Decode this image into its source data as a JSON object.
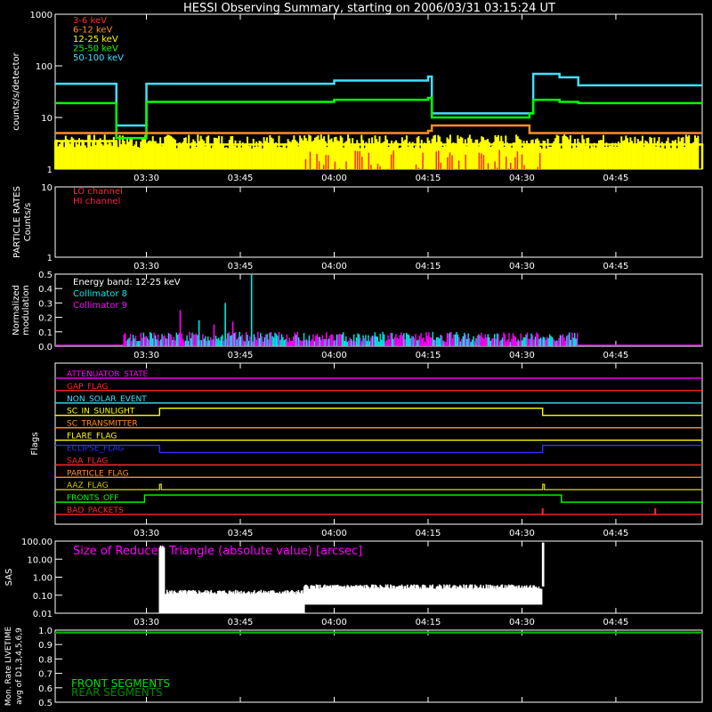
{
  "title": "HESSI Observing Summary, starting on 2006/03/31 03:15:24 UT",
  "colors": {
    "bg": "#000000",
    "axes": "#ffffff",
    "e3_6": "#ff2a2a",
    "e6_12": "#ff8c28",
    "e12_25": "#ffff00",
    "e25_50": "#00ff00",
    "e50_100": "#40e0ff",
    "coll8": "#00e8e8",
    "coll9": "#ff00ff",
    "sas": "#ffffff",
    "front": "#00e000",
    "rear": "#008c00"
  },
  "time_ticks": [
    "03:30",
    "03:45",
    "04:00",
    "04:15",
    "04:30",
    "04:45"
  ],
  "chart_data": [
    {
      "type": "line",
      "panel": "count rates",
      "ylabel": "counts/s/detector",
      "yscale": "log",
      "ylim": [
        1,
        1000
      ],
      "yticks": [
        "1000",
        "100",
        "10",
        "1"
      ],
      "legend": [
        "3-6 keV",
        "6-12 keV",
        "12-25 keV",
        "25-50 keV",
        "50-100 keV"
      ],
      "x_hours": [
        3.257,
        3.4,
        3.42,
        3.49,
        3.5,
        4.0,
        4.25,
        4.26,
        4.28,
        4.52,
        4.53,
        4.6,
        4.65,
        4.98
      ],
      "series": [
        {
          "name": "50-100 keV",
          "values": [
            45,
            45,
            7,
            7,
            45,
            52,
            62,
            12,
            12,
            12,
            70,
            60,
            42,
            42
          ]
        },
        {
          "name": "25-50 keV",
          "values": [
            19,
            19,
            4,
            4,
            20,
            22,
            24,
            10,
            10,
            12,
            22,
            20,
            19,
            19
          ]
        },
        {
          "name": "6-12 keV",
          "values": [
            5,
            5,
            5,
            5,
            5,
            5,
            5.5,
            7,
            7,
            5,
            5,
            5,
            5,
            5
          ]
        },
        {
          "name": "12-25 keV",
          "values": [
            3.5,
            3.5,
            2,
            2,
            3,
            3,
            3,
            3,
            3,
            2.5,
            3,
            3,
            3,
            1
          ]
        }
      ]
    },
    {
      "type": "line",
      "panel": "particle rates",
      "ylabel": "PARTICLE RATES Counts/s",
      "yscale": "log",
      "ylim": [
        1,
        10
      ],
      "yticks": [
        "10",
        "1"
      ],
      "legend": [
        "LO channel",
        "HI channel"
      ]
    },
    {
      "type": "bar",
      "panel": "modulation",
      "ylabel": "Normalized modulation",
      "ylim": [
        0,
        0.5
      ],
      "yticks": [
        "0.5",
        "0.4",
        "0.3",
        "0.2",
        "0.1",
        "0.0"
      ],
      "annotation": "Energy band: 12-25 keV",
      "legend": [
        "Collimator 8",
        "Collimator 9"
      ],
      "range_hours": [
        3.44,
        4.65
      ],
      "spikes": [
        {
          "t": 3.78,
          "v": 0.5,
          "series": "Collimator 8"
        },
        {
          "t": 3.59,
          "v": 0.25,
          "series": "Collimator 9"
        },
        {
          "t": 3.64,
          "v": 0.18,
          "series": "Collimator 8"
        },
        {
          "t": 3.68,
          "v": 0.15,
          "series": "Collimator 9"
        },
        {
          "t": 3.73,
          "v": 0.17,
          "series": "Collimator 9"
        },
        {
          "t": 3.71,
          "v": 0.3,
          "series": "Collimator 8"
        }
      ]
    },
    {
      "type": "line",
      "panel": "flags",
      "ylabel": "Flags",
      "flags": [
        {
          "name": "ATTENUATOR_STATE",
          "color": "#ff00ff"
        },
        {
          "name": "GAP_FLAG",
          "color": "#ff2a2a"
        },
        {
          "name": "NON_SOLAR_EVENT",
          "color": "#40e0ff"
        },
        {
          "name": "SC_IN_SUNLIGHT",
          "color": "#ffff00"
        },
        {
          "name": "SC_TRANSMITTER",
          "color": "#ff8c28"
        },
        {
          "name": "FLARE_FLAG",
          "color": "#ffff00"
        },
        {
          "name": "ECLIPSE_FLAG",
          "color": "#3030ff"
        },
        {
          "name": "SAA_FLAG",
          "color": "#ff2a2a"
        },
        {
          "name": "PARTICLE_FLAG",
          "color": "#ff8c28"
        },
        {
          "name": "AAZ_FLAG",
          "color": "#c8c800"
        },
        {
          "name": "FRONTS_OFF",
          "color": "#00ff00"
        },
        {
          "name": "BAD_PACKETS",
          "color": "#ff2a2a"
        }
      ],
      "sunlight_hours": [
        3.535,
        4.555
      ],
      "eclipse_low_hours": [
        3.535,
        4.555
      ],
      "aaz_pulses_hours": [
        3.535,
        4.555
      ],
      "fronts_off_high_hours": [
        3.495,
        4.605
      ],
      "bad_packet_hours": [
        4.555,
        4.855
      ]
    },
    {
      "type": "area",
      "panel": "SAS",
      "ylabel": "SAS",
      "yscale": "log",
      "ylim": [
        0.01,
        100
      ],
      "yticks": [
        "100.00",
        "10.00",
        "1.00",
        "0.10",
        "0.01"
      ],
      "annotation": "Size of Reduced Triangle (absolute value) [arcsec]",
      "segments": [
        {
          "from": 3.535,
          "to": 3.55,
          "low": 0.01,
          "high": 60
        },
        {
          "from": 3.55,
          "to": 3.92,
          "low": 0.01,
          "high": 0.2
        },
        {
          "from": 3.92,
          "to": 4.555,
          "low": 0.03,
          "high": 0.4
        },
        {
          "from": 4.555,
          "to": 4.56,
          "low": 0.3,
          "high": 100
        }
      ]
    },
    {
      "type": "line",
      "panel": "livetime",
      "ylabel": "Mon. Rate LIVETIME avg of D1,3,4,5,6,9",
      "ylim": [
        0.5,
        1.0
      ],
      "yticks": [
        "1.0",
        "0.9",
        "0.8",
        "0.7",
        "0.6",
        "0.5"
      ],
      "legend": [
        "FRONT SEGMENTS",
        "REAR SEGMENTS"
      ],
      "x_hours": [
        3.257,
        4.98
      ],
      "series": [
        {
          "name": "FRONT SEGMENTS",
          "values": [
            0.985,
            0.985
          ]
        },
        {
          "name": "REAR SEGMENTS",
          "values": [
            0.98,
            0.98
          ]
        }
      ]
    }
  ]
}
